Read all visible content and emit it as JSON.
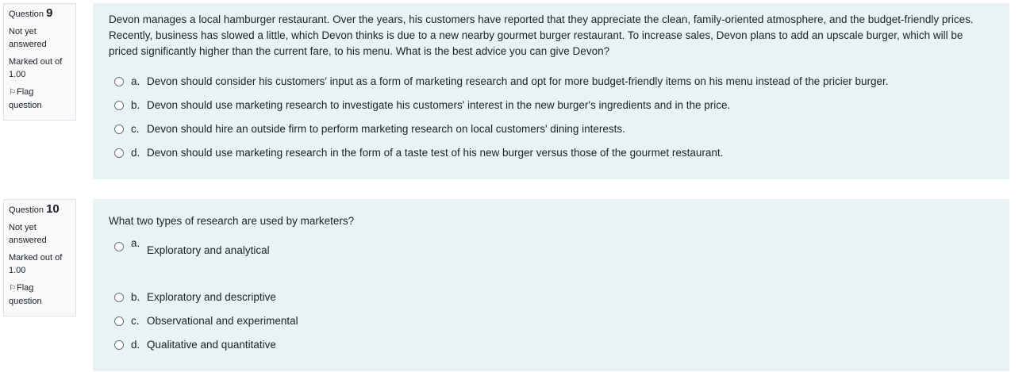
{
  "questions": [
    {
      "label": "Question",
      "number": "9",
      "state": "Not yet answered",
      "grade": "Marked out of 1.00",
      "flag": "Flag question",
      "text": "Devon manages a local hamburger restaurant. Over the years, his customers have reported that they appreciate the clean, family-oriented atmosphere, and the budget-friendly prices. Recently, business has slowed a little, which Devon thinks is due to a new nearby gourmet burger restaurant. To increase sales, Devon plans to add an upscale burger, which will be priced significantly higher than the current fare, to his menu. What is the best advice you can give Devon?",
      "answers": [
        {
          "letter": "a.",
          "text": "Devon should consider his customers' input as a form of marketing research and opt for more budget-friendly items on his menu instead of the pricier burger."
        },
        {
          "letter": "b.",
          "text": "Devon should use marketing research to investigate his customers' interest in the new burger's ingredients and in the price."
        },
        {
          "letter": "c.",
          "text": "Devon should hire an outside firm to perform marketing research on local customers' dining interests."
        },
        {
          "letter": "d.",
          "text": "Devon should use marketing research in the form of a taste test of his new burger versus those of the gourmet restaurant."
        }
      ]
    },
    {
      "label": "Question",
      "number": "10",
      "state": "Not yet answered",
      "grade": "Marked out of 1.00",
      "flag": "Flag question",
      "text": "What two types of research are used by marketers?",
      "answers": [
        {
          "letter": "a.",
          "text": "Exploratory and analytical"
        },
        {
          "letter": "b.",
          "text": "Exploratory and descriptive"
        },
        {
          "letter": "c.",
          "text": "Observational and experimental"
        },
        {
          "letter": "d.",
          "text": "Qualitative and quantitative"
        }
      ]
    }
  ]
}
